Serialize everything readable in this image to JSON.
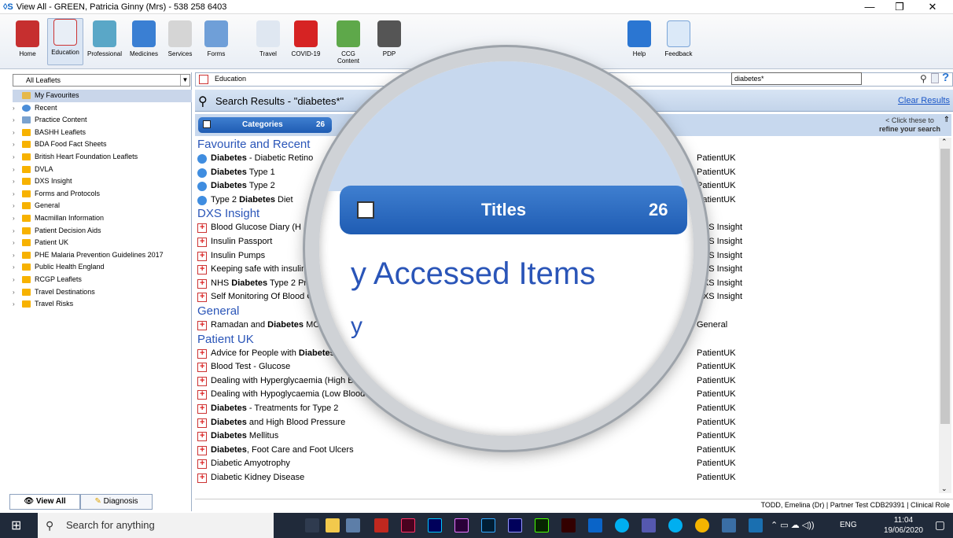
{
  "window": {
    "title": "View All  -  GREEN, Patricia Ginny (Mrs) - 538 258 6403",
    "logo": "◊S",
    "restore_glyph": "❐",
    "close_glyph": "✕"
  },
  "toolbar": {
    "buttons": [
      {
        "label": "Home",
        "icon": "house-icon"
      },
      {
        "label": "Education",
        "icon": "first-aid-icon"
      },
      {
        "label": "Professional",
        "icon": "stethoscope-icon"
      },
      {
        "label": "Medicines",
        "icon": "pill-icon"
      },
      {
        "label": "Services",
        "icon": "ambulance-icon"
      },
      {
        "label": "Forms",
        "icon": "form-icon"
      },
      {
        "label": "Travel",
        "icon": "plane-icon"
      },
      {
        "label": "COVID-19",
        "icon": "siren-icon"
      },
      {
        "label": "CCG Content",
        "icon": "people-icon"
      },
      {
        "label": "PDP",
        "icon": "graduate-icon"
      },
      {
        "label": "Help",
        "icon": "help-icon"
      },
      {
        "label": "Feedback",
        "icon": "feedback-icon"
      }
    ]
  },
  "left": {
    "filter_value": "All Leaflets",
    "tree": [
      {
        "label": "My Favourites",
        "selected": true
      },
      {
        "label": "Recent"
      },
      {
        "label": "Practice Content"
      },
      {
        "label": "BASHH Leaflets"
      },
      {
        "label": "BDA Food Fact Sheets"
      },
      {
        "label": "British Heart Foundation Leaflets"
      },
      {
        "label": "DVLA"
      },
      {
        "label": "DXS Insight"
      },
      {
        "label": "Forms and Protocols"
      },
      {
        "label": "General"
      },
      {
        "label": "Macmillan Information"
      },
      {
        "label": "Patient Decision Aids"
      },
      {
        "label": "Patient UK"
      },
      {
        "label": "PHE Malaria Prevention Guidelines 2017"
      },
      {
        "label": "Public Health England"
      },
      {
        "label": "RCGP Leaflets"
      },
      {
        "label": "Travel Destinations"
      },
      {
        "label": "Travel Risks"
      }
    ],
    "tabs": {
      "view_all": "View All",
      "diagnosis": "Diagnosis"
    }
  },
  "breadcrumb": {
    "label": "Education"
  },
  "search": {
    "value": "diabetes*",
    "help": "?"
  },
  "results": {
    "title": "Search Results - \"diabetes*\"",
    "clear": "Clear Results",
    "categories_label": "Categories",
    "categories_count": "26",
    "refine_line1": "< Click these to",
    "refine_line2": "refine your search"
  },
  "groups": [
    {
      "header": "Favourite and Recent",
      "rows": [
        {
          "bold": "Diabetes",
          "text": " - Diabetic Retino",
          "src": "PatientUK",
          "icon": "globe"
        },
        {
          "bold": "Diabetes",
          "text": " Type 1",
          "src": "PatientUK",
          "icon": "globe"
        },
        {
          "bold": "Diabetes",
          "text": " Type 2",
          "src": "PatientUK",
          "icon": "globe"
        },
        {
          "pre": "Type 2 ",
          "bold": "Diabetes",
          "text": " Diet",
          "src": "PatientUK",
          "icon": "globe"
        }
      ]
    },
    {
      "header": "DXS Insight",
      "rows": [
        {
          "text": "Blood Glucose Diary (H",
          "src": "DXS Insight"
        },
        {
          "text": "Insulin Passport",
          "src": "DXS Insight"
        },
        {
          "text": "Insulin Pumps",
          "src": "DXS Insight"
        },
        {
          "text": "Keeping safe with insulin",
          "src": "DXS Insight"
        },
        {
          "pre": "NHS ",
          "bold": "Diabetes",
          "text": " Type 2 Pre",
          "src": "DXS Insight"
        },
        {
          "text": "Self Monitoring Of Blood Gl",
          "src": "DXS Insight"
        }
      ]
    },
    {
      "header": "General",
      "rows": [
        {
          "pre": "Ramadan and ",
          "bold": "Diabetes",
          "text": " MCB L",
          "src": "General"
        }
      ]
    },
    {
      "header": "Patient UK",
      "rows": [
        {
          "pre": "Advice for People with ",
          "bold": "Diabetes",
          "text": " when",
          "src": "PatientUK"
        },
        {
          "text": "Blood Test - Glucose",
          "src": "PatientUK"
        },
        {
          "text": "Dealing with Hyperglycaemia (High Blood Suga",
          "src": "PatientUK"
        },
        {
          "text": "Dealing with Hypoglycaemia (Low Blood Sugar)",
          "src": "PatientUK"
        },
        {
          "bold": "Diabetes",
          "text": " - Treatments for Type 2",
          "src": "PatientUK"
        },
        {
          "bold": "Diabetes",
          "text": " and High Blood Pressure",
          "src": "PatientUK"
        },
        {
          "bold": "Diabetes",
          "text": " Mellitus",
          "src": "PatientUK"
        },
        {
          "bold": "Diabetes",
          "text": ", Foot Care and Foot Ulcers",
          "src": "PatientUK"
        },
        {
          "text": "Diabetic Amyotrophy",
          "src": "PatientUK"
        },
        {
          "text": "Diabetic Kidney Disease",
          "src": "PatientUK"
        }
      ]
    }
  ],
  "magnifier": {
    "titles_label": "Titles",
    "titles_count": "26",
    "big_text": "y Accessed Items",
    "frag_top": "s*\"",
    "frag_bottom": "y"
  },
  "status": {
    "user": "TODD, Emelina (Dr)  |  Partner Test CDB29391  |  Clinical Role"
  },
  "taskbar": {
    "search_placeholder": "Search for anything",
    "lang": "ENG",
    "time": "11:04",
    "date": "19/06/2020"
  }
}
